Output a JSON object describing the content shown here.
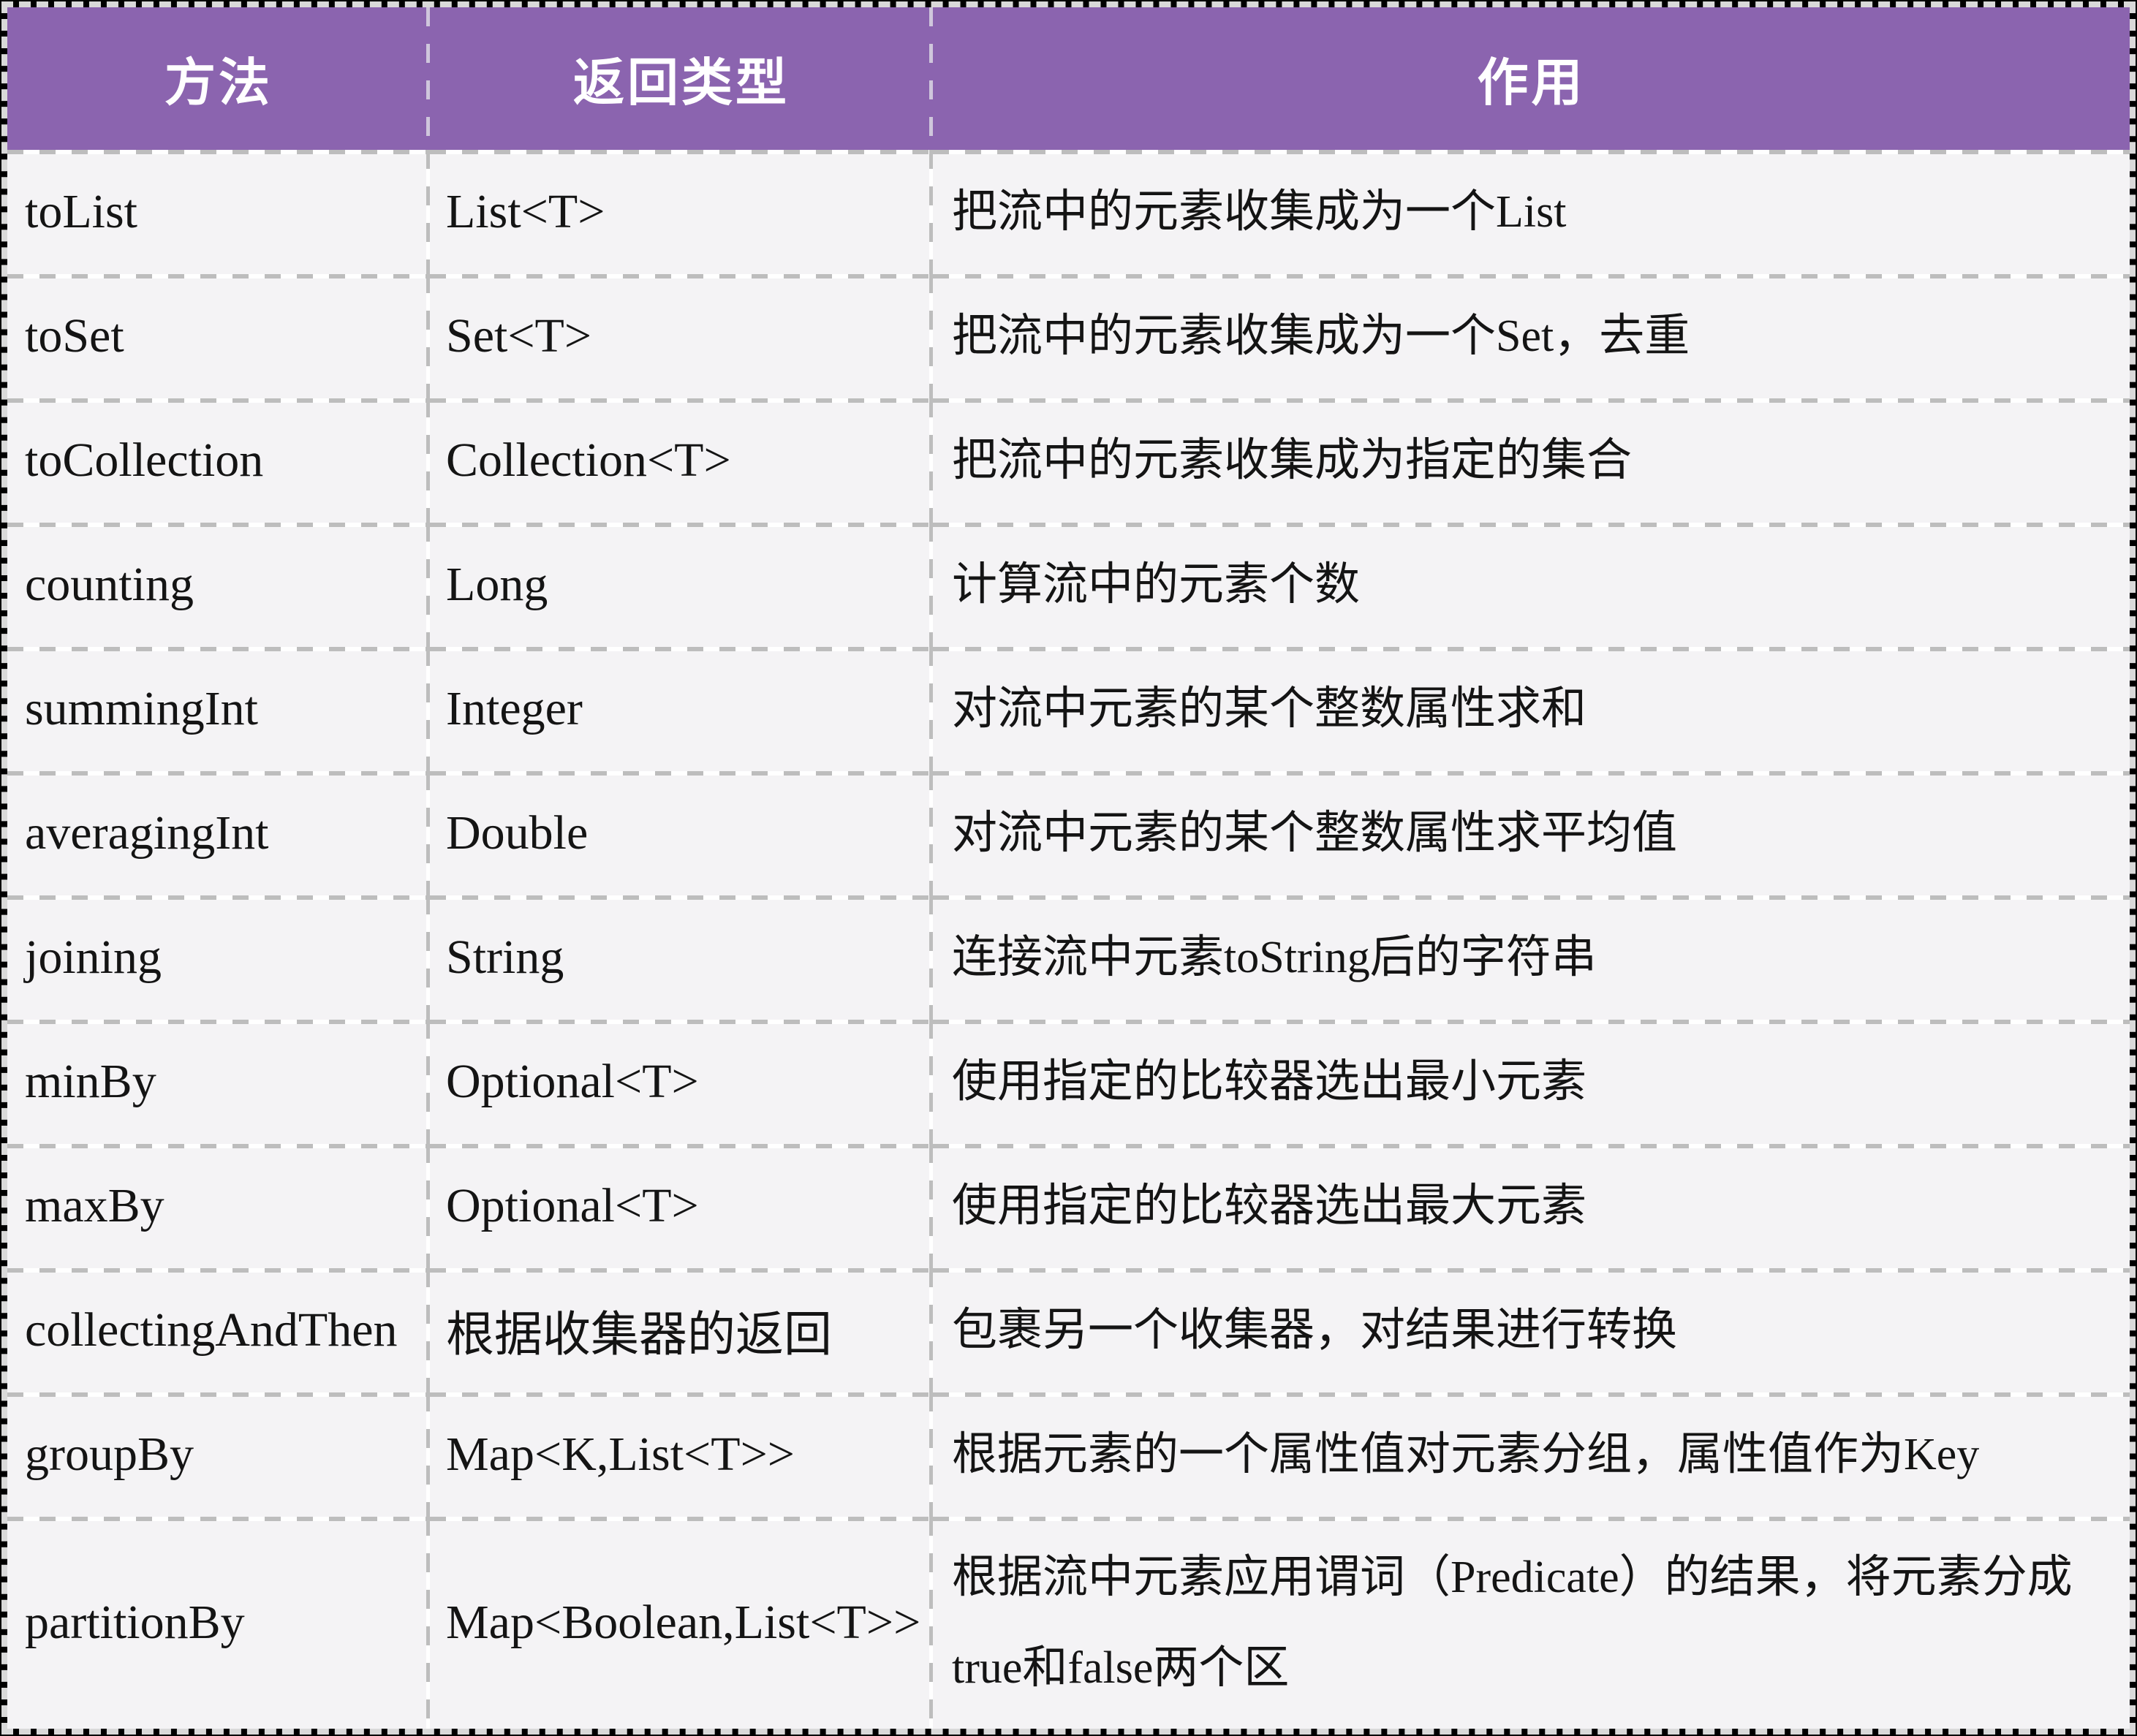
{
  "table": {
    "header": {
      "columns": [
        "方法",
        "返回类型",
        "作用"
      ]
    },
    "rows": [
      {
        "method": "toList",
        "return_type": "List<T>",
        "description": "把流中的元素收集成为一个List"
      },
      {
        "method": "toSet",
        "return_type": "Set<T>",
        "description": "把流中的元素收集成为一个Set，去重"
      },
      {
        "method": "toCollection",
        "return_type": "Collection<T>",
        "description": "把流中的元素收集成为指定的集合"
      },
      {
        "method": "counting",
        "return_type": "Long",
        "description": "计算流中的元素个数"
      },
      {
        "method": "summingInt",
        "return_type": "Integer",
        "description": "对流中元素的某个整数属性求和"
      },
      {
        "method": "averagingInt",
        "return_type": "Double",
        "description": "对流中元素的某个整数属性求平均值"
      },
      {
        "method": "joining",
        "return_type": "String",
        "description": "连接流中元素toString后的字符串"
      },
      {
        "method": "minBy",
        "return_type": "Optional<T>",
        "description": "使用指定的比较器选出最小元素"
      },
      {
        "method": "maxBy",
        "return_type": "Optional<T>",
        "description": "使用指定的比较器选出最大元素"
      },
      {
        "method": "collectingAndThen",
        "return_type": "根据收集器的返回",
        "description": "包裹另一个收集器，对结果进行转换"
      },
      {
        "method": "groupBy",
        "return_type": "Map<K,List<T>>",
        "description": "根据元素的一个属性值对元素分组，属性值作为Key"
      },
      {
        "method": "partitionBy",
        "return_type": "Map<Boolean,List<T>>",
        "description": "根据流中元素应用谓词（Predicate）的结果，将元素分成true和false两个区"
      }
    ],
    "colors": {
      "header_bg": "#8b64af",
      "header_text": "#ffffff",
      "cell_bg": "#f4f3f5",
      "grid_line": "#bdbdbd",
      "frame_dash": "#d9d9d9",
      "text": "#141414"
    }
  }
}
